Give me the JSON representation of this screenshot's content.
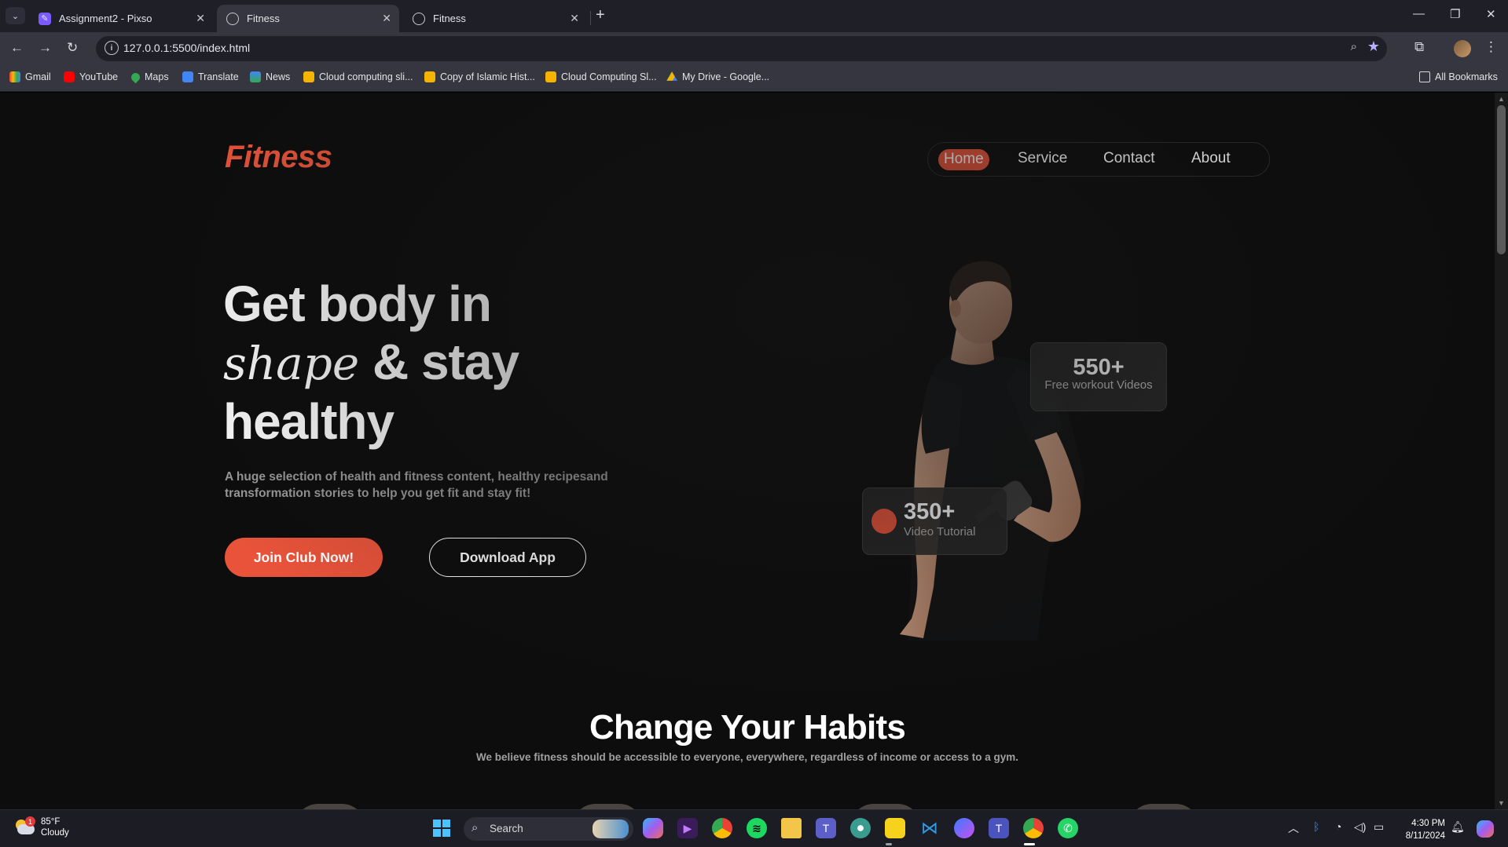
{
  "browser": {
    "tabs": [
      {
        "title": "Assignment2 - Pixso",
        "active": false
      },
      {
        "title": "Fitness",
        "active": true
      },
      {
        "title": "Fitness",
        "active": false
      }
    ],
    "url": "127.0.0.1:5500/index.html",
    "bookmarks": [
      {
        "label": "Gmail",
        "icon": "gmail-icon"
      },
      {
        "label": "YouTube",
        "icon": "youtube-icon"
      },
      {
        "label": "Maps",
        "icon": "maps-icon"
      },
      {
        "label": "Translate",
        "icon": "translate-icon"
      },
      {
        "label": "News",
        "icon": "news-icon"
      },
      {
        "label": "Cloud computing sli...",
        "icon": "slides-icon"
      },
      {
        "label": "Copy of Islamic Hist...",
        "icon": "slides-icon"
      },
      {
        "label": "Cloud Computing Sl...",
        "icon": "slides-icon"
      },
      {
        "label": "My Drive - Google...",
        "icon": "drive-icon"
      }
    ],
    "all_bookmarks": "All Bookmarks"
  },
  "site": {
    "logo": "Fitness",
    "nav": [
      "Home",
      "Service",
      "Contact",
      "About"
    ],
    "hero": {
      "line1": "Get body in",
      "script_word": "shape",
      "line2_rest": "& stay",
      "line3": "healthy",
      "description": "A huge selection of health and fitness content, healthy recipesand transformation stories to help you get fit and stay fit!",
      "join_button": "Join Club Now!",
      "download_button": "Download App"
    },
    "stats": [
      {
        "number": "550+",
        "label": "Free workout Videos"
      },
      {
        "number": "350+",
        "label": "Video Tutorial"
      }
    ],
    "habits": {
      "title": "Change Your Habits",
      "subtitle": "We believe fitness should be accessible to everyone, everywhere, regardless of income or access to a gym."
    },
    "accent_color": "#e8533a"
  },
  "taskbar": {
    "weather": {
      "temp": "85°F",
      "condition": "Cloudy",
      "badge": "1"
    },
    "search_label": "Search",
    "time": "4:30 PM",
    "date": "8/11/2024"
  }
}
